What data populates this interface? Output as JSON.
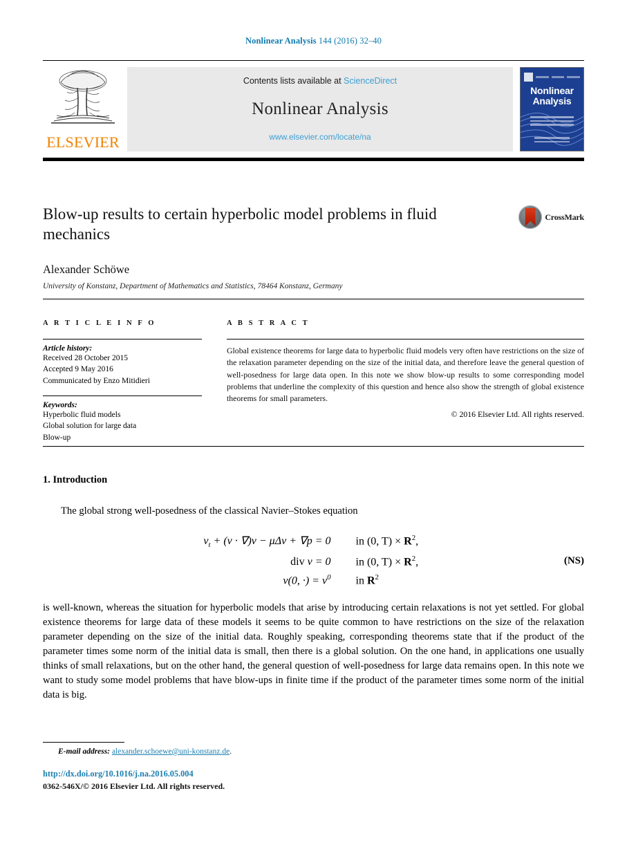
{
  "running_head": {
    "journal": "Nonlinear Analysis",
    "citation": " 144 (2016) 32–40"
  },
  "masthead": {
    "publisher": "ELSEVIER",
    "contents_prefix": "Contents lists available at ",
    "sciencedirect": "ScienceDirect",
    "journal_title": "Nonlinear Analysis",
    "journal_url": "www.elsevier.com/locate/na",
    "cover_title_line1": "Nonlinear",
    "cover_title_line2": "Analysis",
    "colors": {
      "elsevier_orange": "#ef8200",
      "link_blue": "#3d9fd4",
      "band_grey": "#e9e9e9",
      "cover_blue": "#1c3f91",
      "running_head_blue": "#0f7bb0"
    }
  },
  "article": {
    "title": "Blow-up results to certain hyperbolic model problems in fluid mechanics",
    "author": "Alexander Schöwe",
    "affiliation": "University of Konstanz, Department of Mathematics and Statistics, 78464 Konstanz, Germany",
    "crossmark_label": "CrossMark"
  },
  "article_info": {
    "heading": "A R T I C L E   I N F O",
    "history_label": "Article history:",
    "history": [
      "Received 28 October 2015",
      "Accepted 9 May 2016",
      "Communicated by Enzo Mitidieri"
    ],
    "keywords_label": "Keywords:",
    "keywords": [
      "Hyperbolic fluid models",
      "Global solution for large data",
      "Blow-up"
    ]
  },
  "abstract": {
    "heading": "A B S T R A C T",
    "text": "Global existence theorems for large data to hyperbolic fluid models very often have restrictions on the size of the relaxation parameter depending on the size of the initial data, and therefore leave the general question of well-posedness for large data open. In this note we show blow-up results to some corresponding model problems that underline the complexity of this question and hence also show the strength of global existence theorems for small parameters.",
    "copyright": "© 2016 Elsevier Ltd. All rights reserved."
  },
  "body": {
    "section_heading": "1.  Introduction",
    "lead_paragraph": "The global strong well-posedness of the classical Navier–Stokes equation",
    "equation": {
      "tag": "(NS)",
      "rows": [
        {
          "lhs_html": "v<span class=\"sub\">t</span> + (v · ∇)v − μΔv + ∇p  =  0",
          "rhs_html": "<span class=\"rm\">in</span> (0, T) × <span class=\"bb\">R</span><span class=\"up\">2</span>,"
        },
        {
          "lhs_html": "<span class=\"rm\">div</span> v  =  0",
          "rhs_html": "<span class=\"rm\">in</span> (0, T) × <span class=\"bb\">R</span><span class=\"up\">2</span>,"
        },
        {
          "lhs_html": "v(0, ·)  =  v<span class=\"up\">0</span>",
          "rhs_html": "<span class=\"rm\">in</span> <span class=\"bb\">R</span><span class=\"up\">2</span>"
        }
      ]
    },
    "main_paragraph": "is well-known, whereas the situation for hyperbolic models that arise by introducing certain relaxations is not yet settled. For global existence theorems for large data of these models it seems to be quite common to have restrictions on the size of the relaxation parameter depending on the size of the initial data. Roughly speaking, corresponding theorems state that if the product of the parameter times some norm of the initial data is small, then there is a global solution. On the one hand, in applications one usually thinks of small relaxations, but on the other hand, the general question of well-posedness for large data remains open. In this note we want to study some model problems that have blow-ups in finite time if the product of the parameter times some norm of the initial data is big."
  },
  "footer": {
    "email_label": "E-mail address:",
    "email": "alexander.schoewe@uni-konstanz.de",
    "email_trailing": ".",
    "doi": "http://dx.doi.org/10.1016/j.na.2016.05.004",
    "issn_copyright": "0362-546X/© 2016 Elsevier Ltd. All rights reserved."
  }
}
